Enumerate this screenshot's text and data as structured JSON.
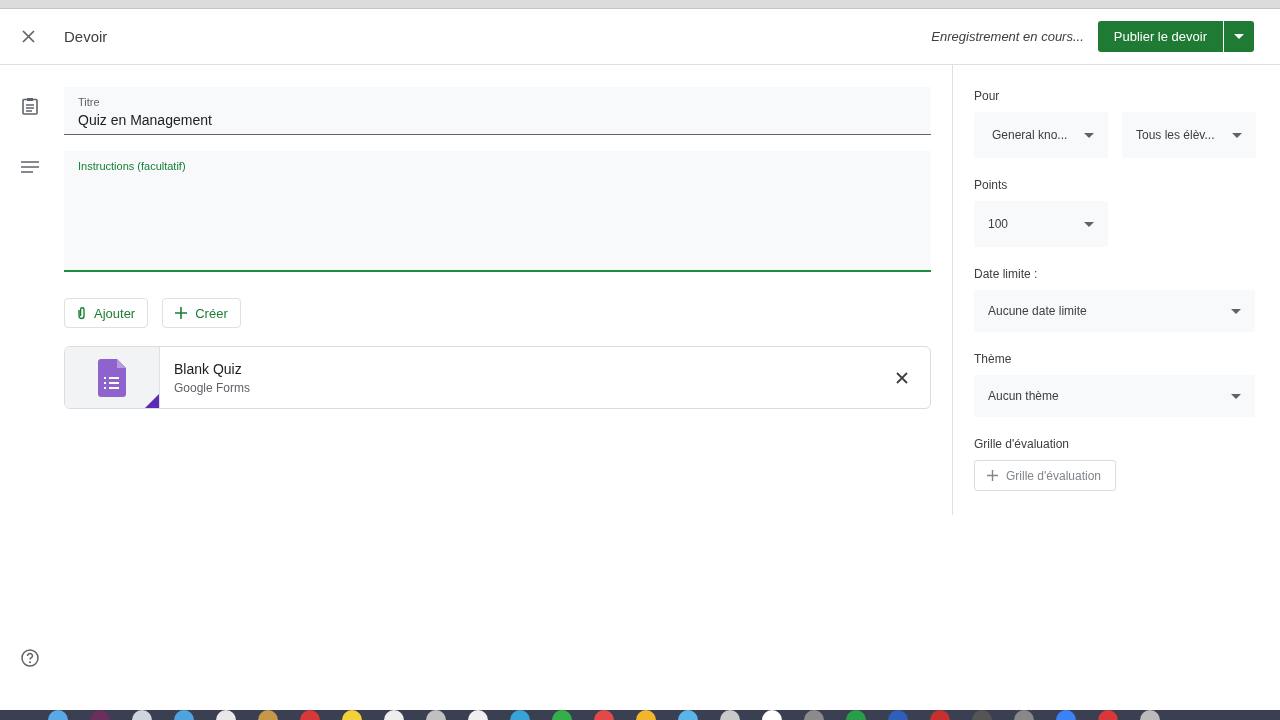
{
  "header": {
    "title": "Devoir",
    "status": "Enregistrement en cours...",
    "publish_button": "Publier le devoir"
  },
  "form": {
    "title_field": {
      "label": "Titre",
      "value": "Quiz en Management"
    },
    "instructions_field": {
      "label": "Instructions (facultatif)",
      "focused": true
    },
    "buttons": [
      {
        "kind": "attach",
        "label": "Ajouter"
      },
      {
        "kind": "create",
        "label": "Créer"
      }
    ],
    "attachment": {
      "title": "Blank Quiz",
      "subtitle": "Google Forms"
    }
  },
  "sidebar": {
    "for_label": "Pour",
    "class_select": "General kno...",
    "students_select": "Tous les élèv...",
    "points_label": "Points",
    "points_select": "100",
    "due_label": "Date limite :",
    "due_select": "Aucune date limite",
    "topic_label": "Thème",
    "topic_select": "Aucun thème",
    "rubric_label": "Grille d'évaluation",
    "rubric_button": "Grille d'évaluation"
  }
}
